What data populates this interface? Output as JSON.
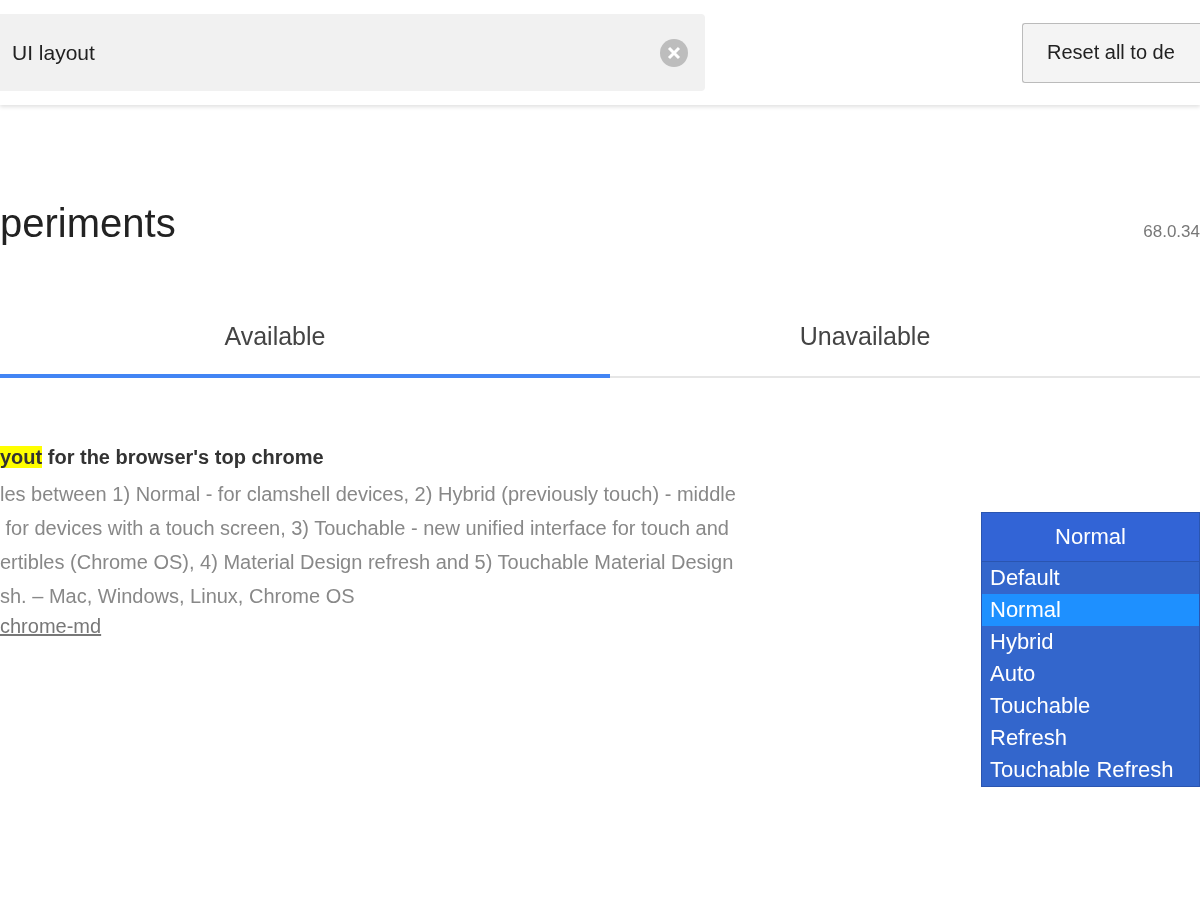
{
  "search": {
    "value": "UI layout"
  },
  "reset_button": "Reset all to de",
  "page_title": "periments",
  "version": "68.0.34",
  "tabs": [
    {
      "label": "Available",
      "selected": true
    },
    {
      "label": "Unavailable",
      "selected": false
    }
  ],
  "experiment": {
    "title_highlight": "yout",
    "title_rest": " for the browser's top chrome",
    "description_lines": [
      "les between 1) Normal - for clamshell devices, 2) Hybrid (previously touch) - middle",
      " for devices with a touch screen, 3) Touchable - new unified interface for touch and",
      "ertibles (Chrome OS), 4) Material Design refresh and 5) Touchable Material Design",
      "sh. – Mac, Windows, Linux, Chrome OS"
    ],
    "link": "chrome-md",
    "dropdown": {
      "value": "Normal",
      "expanded": true,
      "options": [
        {
          "label": "Default",
          "selected": false
        },
        {
          "label": "Normal",
          "selected": true
        },
        {
          "label": "Hybrid",
          "selected": false
        },
        {
          "label": "Auto",
          "selected": false
        },
        {
          "label": "Touchable",
          "selected": false
        },
        {
          "label": "Refresh",
          "selected": false
        },
        {
          "label": "Touchable Refresh",
          "selected": false
        }
      ]
    }
  }
}
